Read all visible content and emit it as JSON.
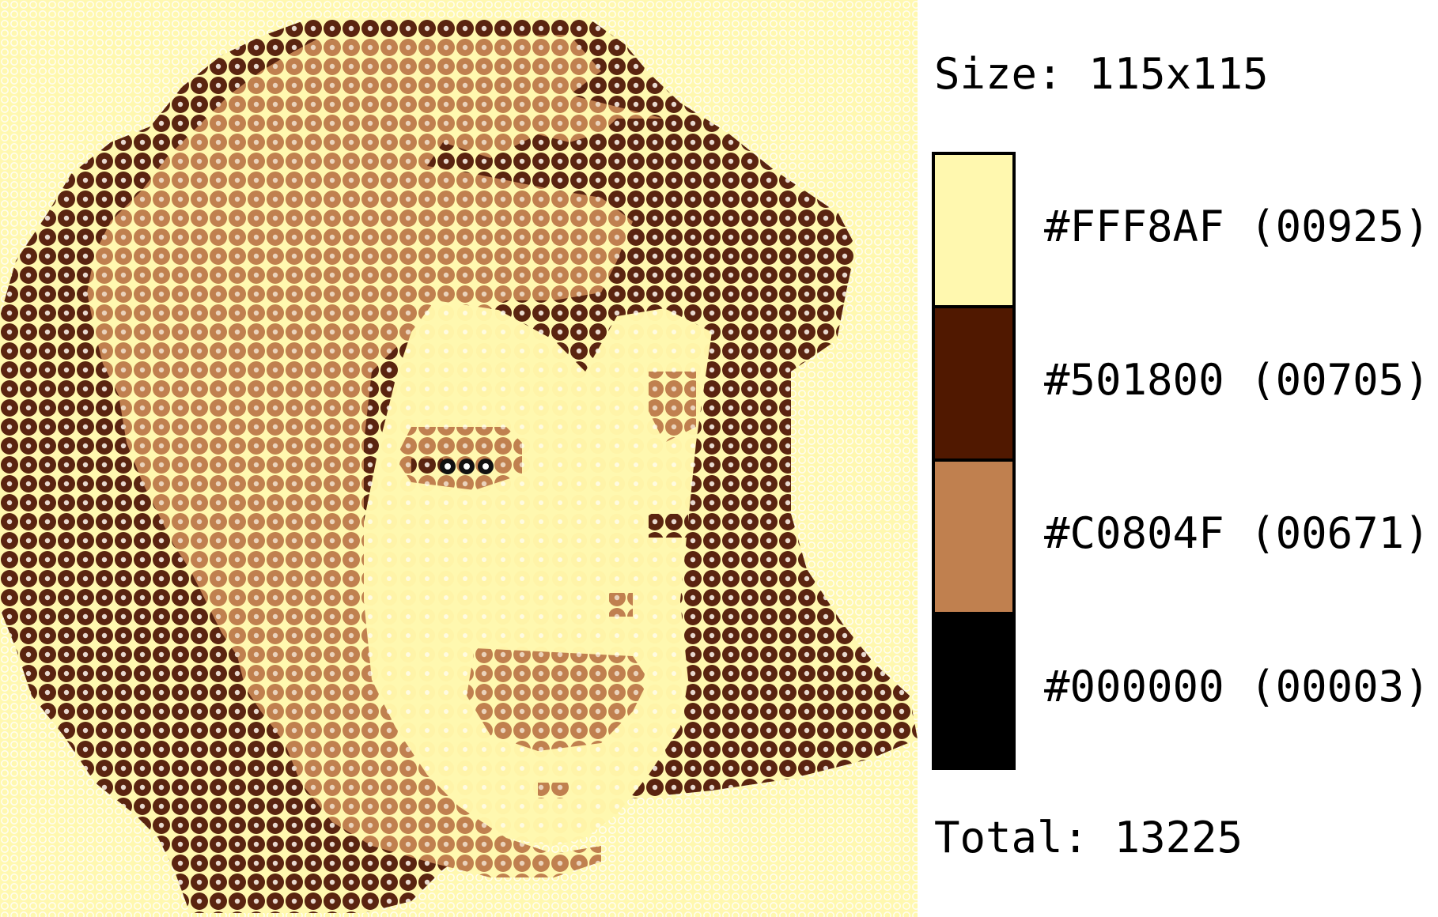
{
  "size_label": "Size: 115x115",
  "total_label": "Total: 13225",
  "palette": [
    {
      "hex": "#FFF8AF",
      "label": "#FFF8AF (00925)"
    },
    {
      "hex": "#501800",
      "label": "#501800 (00705)"
    },
    {
      "hex": "#C0804F",
      "label": "#C0804F (00671)"
    },
    {
      "hex": "#000000",
      "label": "#000000 (00003)"
    }
  ]
}
